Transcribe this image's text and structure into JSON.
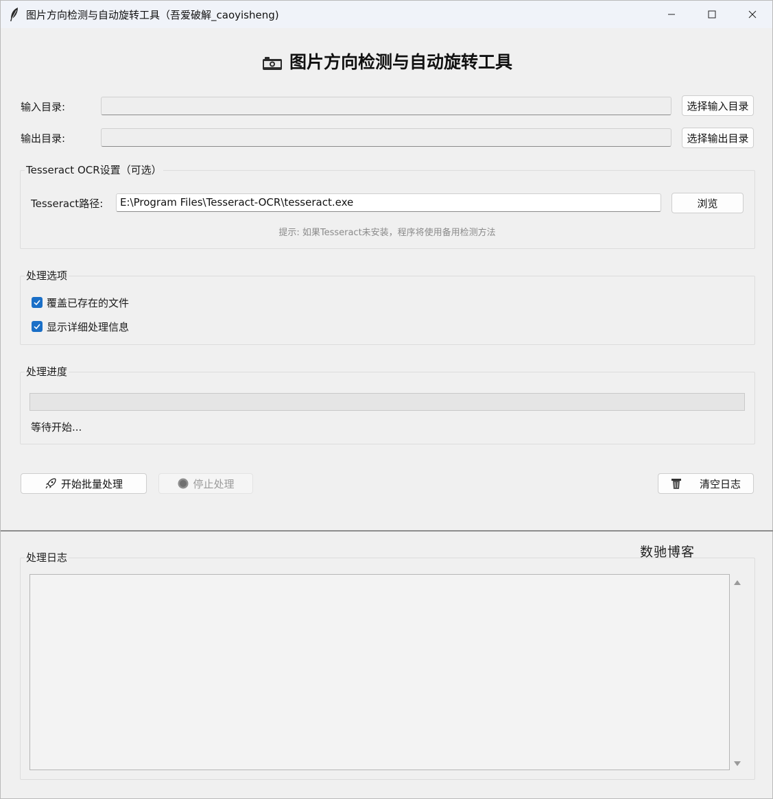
{
  "window": {
    "title": "图片方向检测与自动旋转工具（吾爱破解_caoyisheng)",
    "min_label": "—",
    "max_label": "☐",
    "close_label": "✕"
  },
  "header": {
    "title": "图片方向检测与自动旋转工具"
  },
  "directories": {
    "input_label": "输入目录:",
    "input_value": "",
    "input_button": "选择输入目录",
    "output_label": "输出目录:",
    "output_value": "",
    "output_button": "选择输出目录"
  },
  "ocr": {
    "group_title": "Tesseract OCR设置（可选）",
    "path_label": "Tesseract路径:",
    "path_value": "E:\\Program Files\\Tesseract-OCR\\tesseract.exe",
    "browse_button": "浏览",
    "hint": "提示: 如果Tesseract未安装，程序将使用备用检测方法"
  },
  "options": {
    "group_title": "处理选项",
    "items": [
      {
        "label": "覆盖已存在的文件",
        "checked": true
      },
      {
        "label": "显示详细处理信息",
        "checked": true
      }
    ]
  },
  "progress": {
    "group_title": "处理进度",
    "value": 0,
    "status": "等待开始..."
  },
  "actions": {
    "start_button": "开始批量处理",
    "stop_button": "停止处理",
    "clear_button": "清空日志"
  },
  "log": {
    "group_title": "处理日志",
    "content": "",
    "watermark": "数驰博客"
  },
  "colors": {
    "accent": "#1a6fc7",
    "progress": "#06b025"
  },
  "icons": {
    "app": "feather-icon",
    "camera": "camera-icon",
    "start": "rocket-icon",
    "stop": "stop-circle-icon",
    "clear": "trash-icon"
  }
}
